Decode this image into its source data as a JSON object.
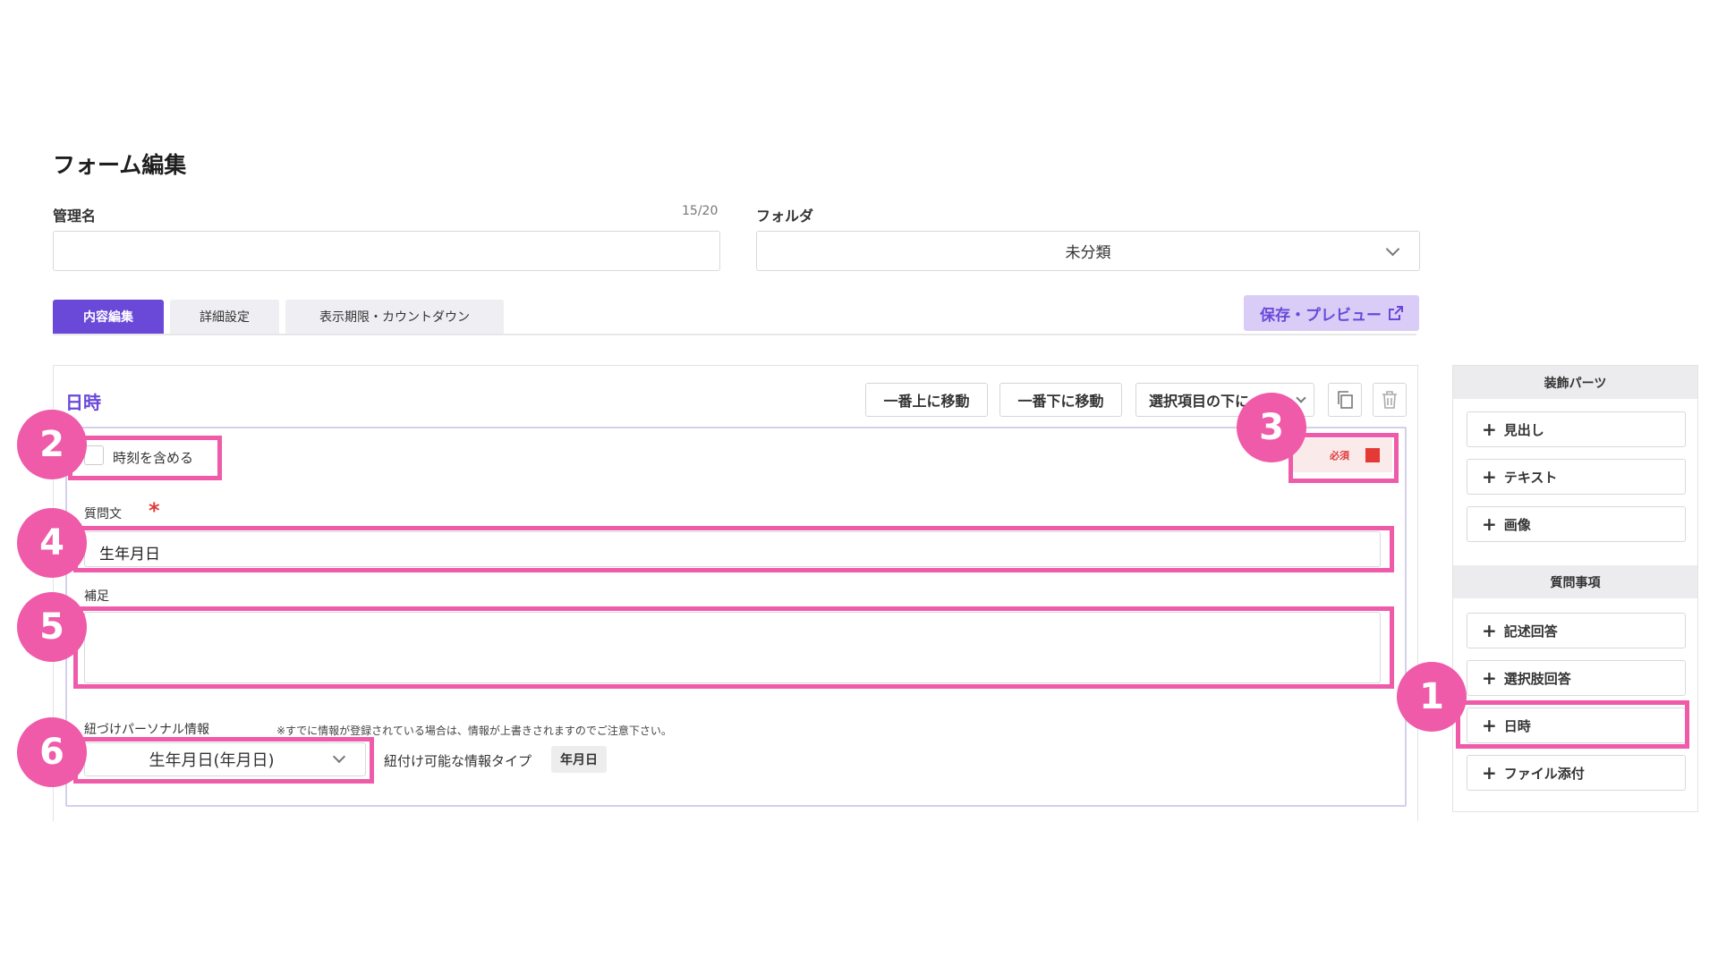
{
  "page": {
    "title": "フォーム編集"
  },
  "name_field": {
    "label": "管理名",
    "counter": "15/20",
    "value": ""
  },
  "folder_field": {
    "label": "フォルダ",
    "selected": "未分類"
  },
  "tabs": [
    {
      "label": "内容編集",
      "active": true
    },
    {
      "label": "詳細設定",
      "active": false
    },
    {
      "label": "表示期限・カウントダウン",
      "active": false
    }
  ],
  "save_preview": {
    "label": "保存・プレビュー",
    "icon": "external-link-icon"
  },
  "item": {
    "title": "日時",
    "toolbar": {
      "move_top": "一番上に移動",
      "move_bottom": "一番下に移動",
      "move_below_selected": "選択項目の下に",
      "copy_icon": "copy-icon",
      "delete_icon": "trash-icon"
    },
    "include_time": {
      "label": "時刻を含める",
      "checked": false
    },
    "required": {
      "label": "必須",
      "checked": true
    },
    "question": {
      "label": "質問文",
      "value": "生年月日"
    },
    "supplement": {
      "label": "補足",
      "value": ""
    },
    "personal_info": {
      "label": "紐づけパーソナル情報",
      "note": "※すでに情報が登録されている場合は、情報が上書きされますのでご注意下さい。",
      "selected": "生年月日(年月日)",
      "type_label": "紐付け可能な情報タイプ",
      "type_value": "年月日"
    }
  },
  "sidebar": {
    "decor_heading": "装飾パーツ",
    "decor_items": [
      "見出し",
      "テキスト",
      "画像"
    ],
    "question_heading": "質問事項",
    "question_items": [
      "記述回答",
      "選択肢回答",
      "日時",
      "ファイル添付"
    ]
  },
  "annotations": [
    "1",
    "2",
    "3",
    "4",
    "5",
    "6"
  ],
  "colors": {
    "accent": "#6a49d9",
    "highlight": "#ef5aa9",
    "required": "#e53935"
  }
}
